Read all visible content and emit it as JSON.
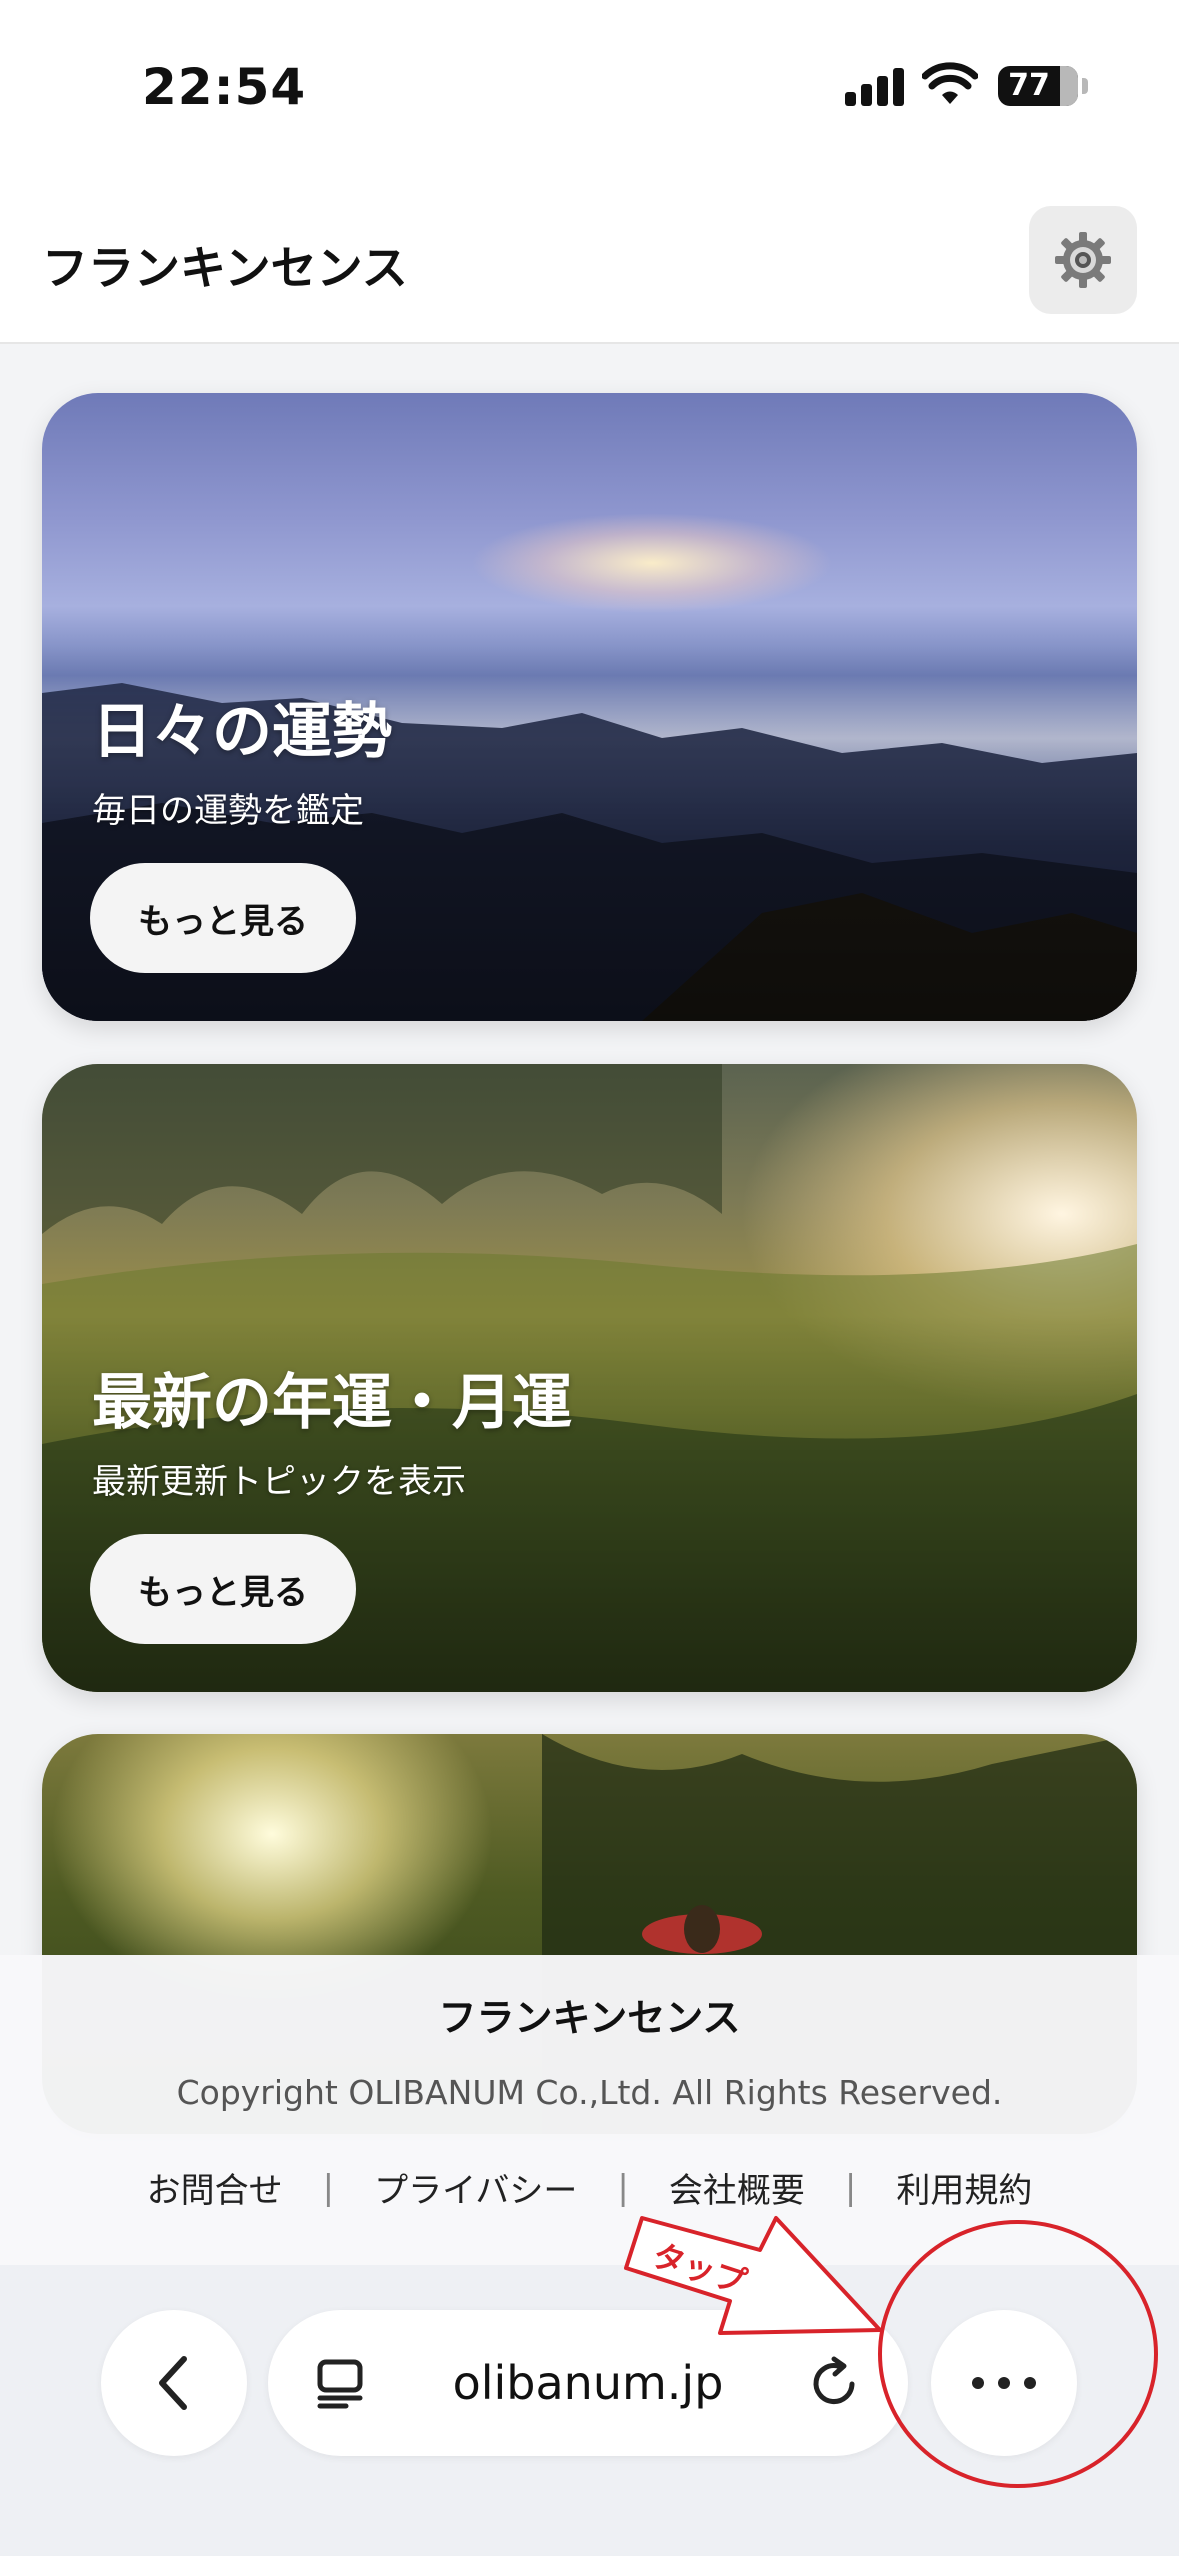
{
  "status": {
    "time": "22:54",
    "battery": "77"
  },
  "header": {
    "title": "フランキンセンス"
  },
  "cards": [
    {
      "title": "日々の運勢",
      "subtitle": "毎日の運勢を鑑定",
      "button": "もっと見る"
    },
    {
      "title": "最新の年運・月運",
      "subtitle": "最新更新トピックを表示",
      "button": "もっと見る"
    }
  ],
  "footer": {
    "title": "フランキンセンス",
    "copyright": "Copyright OLIBANUM Co.,Ltd. All Rights Reserved.",
    "links": [
      "お問合せ",
      "プライバシー",
      "会社概要",
      "利用規約"
    ],
    "separator": "|"
  },
  "browser": {
    "url": "olibanum.jp"
  },
  "annotation": {
    "label": "タップ",
    "color": "#d8232a"
  }
}
